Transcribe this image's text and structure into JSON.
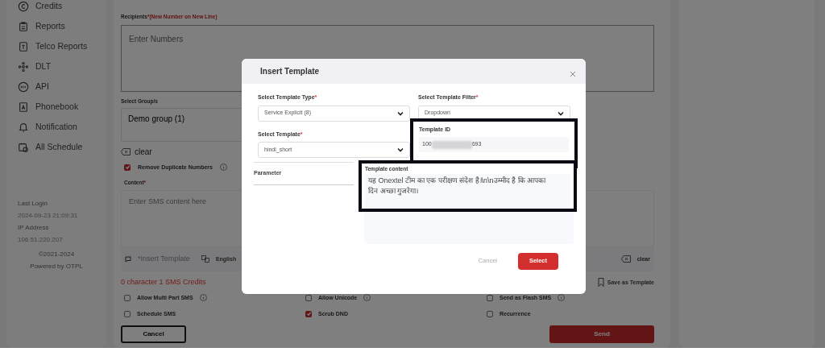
{
  "sidebar": {
    "items": [
      {
        "label": "Credits"
      },
      {
        "label": "Reports"
      },
      {
        "label": "Telco Reports"
      },
      {
        "label": "DLT"
      },
      {
        "label": "API"
      },
      {
        "label": "Phonebook"
      },
      {
        "label": "Notification"
      },
      {
        "label": "All Schedule"
      }
    ],
    "last_login": {
      "label": "Last Login",
      "value": "2024-09-23 21:09:31"
    },
    "ip_address": {
      "label": "IP Address",
      "value": "106.51.220.207"
    },
    "copyright": "©2021-2024",
    "powered_by": "Powered by OTPL"
  },
  "form": {
    "recipients": {
      "label": "Recipients",
      "required_mark": "*",
      "hint": "(New Number on New Line)",
      "placeholder": "Enter Numbers"
    },
    "groups": {
      "label": "Select Group/s",
      "value": "Demo group (1)",
      "clear": "clear"
    },
    "remove_duplicates": {
      "label": "Remove Duplicate Numbers",
      "checked": true
    },
    "content": {
      "label": "Content",
      "required_mark": "*",
      "placeholder": "Enter SMS content here"
    },
    "toolbar": {
      "insert_template": "*Insert Template",
      "language": "English",
      "clear": "clear"
    },
    "credits": "0 character 1 SMS Credits",
    "save_template": "Save as Template",
    "options": [
      {
        "label": "Allow Multi Part SMS",
        "checked": false,
        "info": true
      },
      {
        "label": "Allow Unicode",
        "checked": false,
        "info": true
      },
      {
        "label": "Send as Flash SMS",
        "checked": false,
        "info": true
      },
      {
        "label": "Schedule SMS",
        "checked": false,
        "info": false
      },
      {
        "label": "Scrub DND",
        "checked": true,
        "info": false
      },
      {
        "label": "Recurrence",
        "checked": false,
        "info": false
      }
    ],
    "cancel": "Cancel",
    "send": "Send"
  },
  "modal": {
    "title": "Insert Template",
    "template_type": {
      "label": "Select Template Type",
      "required_mark": "*",
      "value": "Service Explicit (8)"
    },
    "template_filter": {
      "label": "Select Template Filter",
      "required_mark": "*",
      "value": "Dropdown"
    },
    "template": {
      "label": "Select Template",
      "required_mark": "*",
      "value": "hindi_short"
    },
    "template_id": {
      "label": "Template ID",
      "prefix": "100",
      "suffix": "693"
    },
    "parameter": "Parameter",
    "template_content": {
      "label": "Template content",
      "value": "यह Onextel टीम का एक परीक्षण संदेश है।\\n\\nउम्मीद है कि आपका दिन अच्छा गुजरेगा।"
    },
    "cancel": "Cancel",
    "select": "Select"
  }
}
